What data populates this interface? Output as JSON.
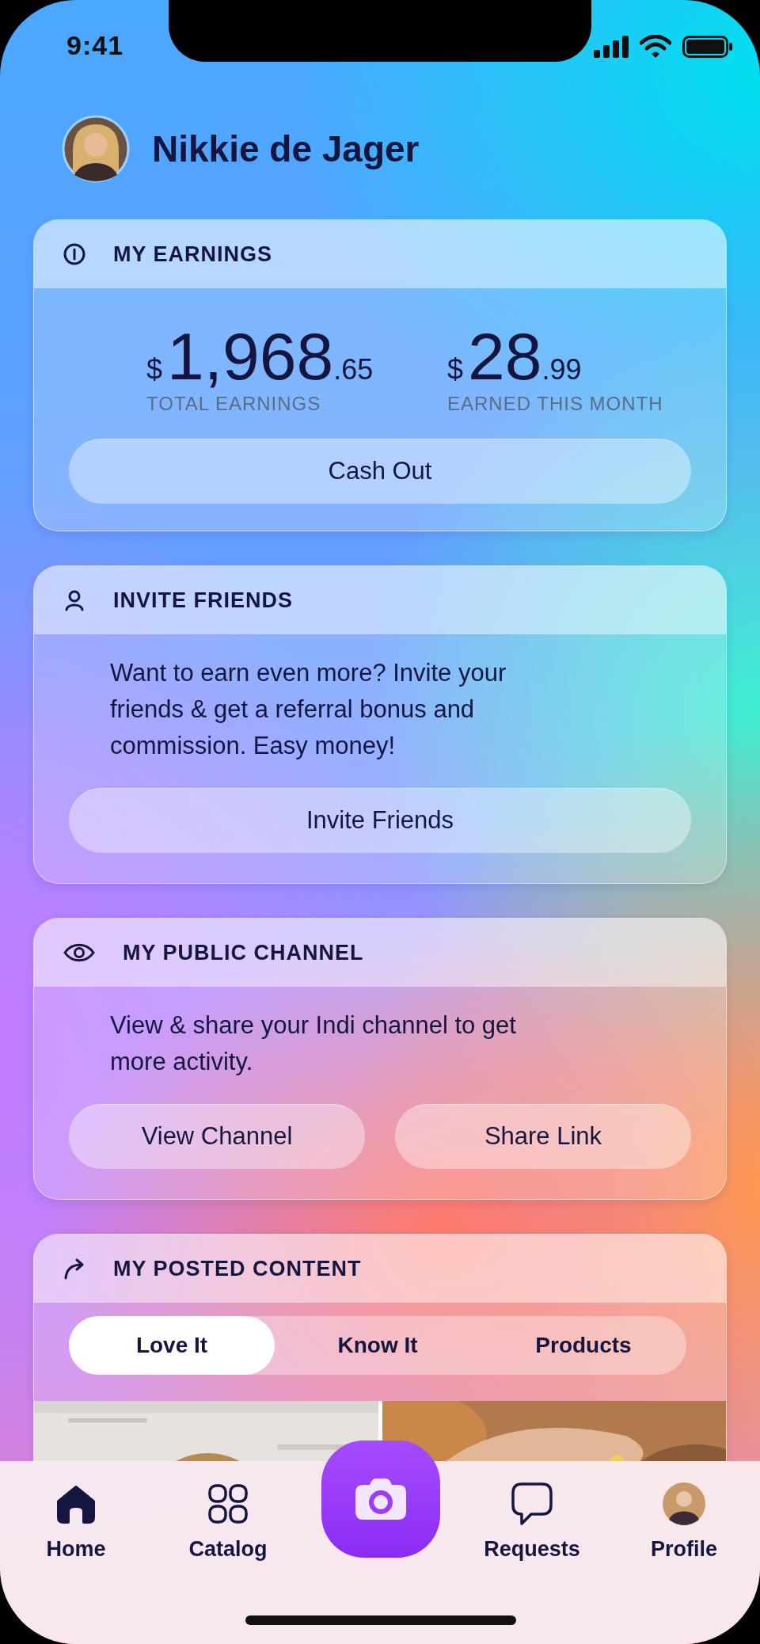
{
  "status_bar": {
    "time": "9:41"
  },
  "profile": {
    "name": "Nikkie de Jager"
  },
  "cards": [
    {
      "kind": "earnings",
      "title": "MY EARNINGS",
      "amounts": [
        {
          "currency": "$",
          "whole": "1,968",
          "cents": ".65",
          "label": "TOTAL EARNINGS"
        },
        {
          "currency": "$",
          "whole": "28",
          "cents": ".99",
          "label": "EARNED THIS MONTH"
        }
      ],
      "buttons": [
        "Cash Out"
      ]
    },
    {
      "kind": "text",
      "title": "INVITE FRIENDS",
      "text": "Want to earn even more? Invite your friends & get a referral bonus and commission. Easy money!",
      "buttons": [
        "Invite Friends"
      ]
    },
    {
      "kind": "text",
      "title": "MY PUBLIC CHANNEL",
      "text": "View & share your Indi channel to get more activity.",
      "buttons": [
        "View Channel",
        "Share Link"
      ]
    },
    {
      "kind": "content",
      "title": "MY POSTED CONTENT",
      "tabs": [
        {
          "label": "Love It",
          "selected": true
        },
        {
          "label": "Know It",
          "selected": false
        },
        {
          "label": "Products",
          "selected": false
        }
      ],
      "posts": [
        {
          "kind": "picture"
        },
        {
          "kind": "picture"
        }
      ]
    }
  ],
  "nav": [
    {
      "kind": "tab",
      "label": "Home",
      "selected": true
    },
    {
      "kind": "tab",
      "label": "Catalog",
      "selected": false
    },
    {
      "kind": "camera"
    },
    {
      "kind": "tab",
      "label": "Requests",
      "selected": false
    },
    {
      "kind": "tab",
      "label": "Profile",
      "selected": false
    }
  ]
}
